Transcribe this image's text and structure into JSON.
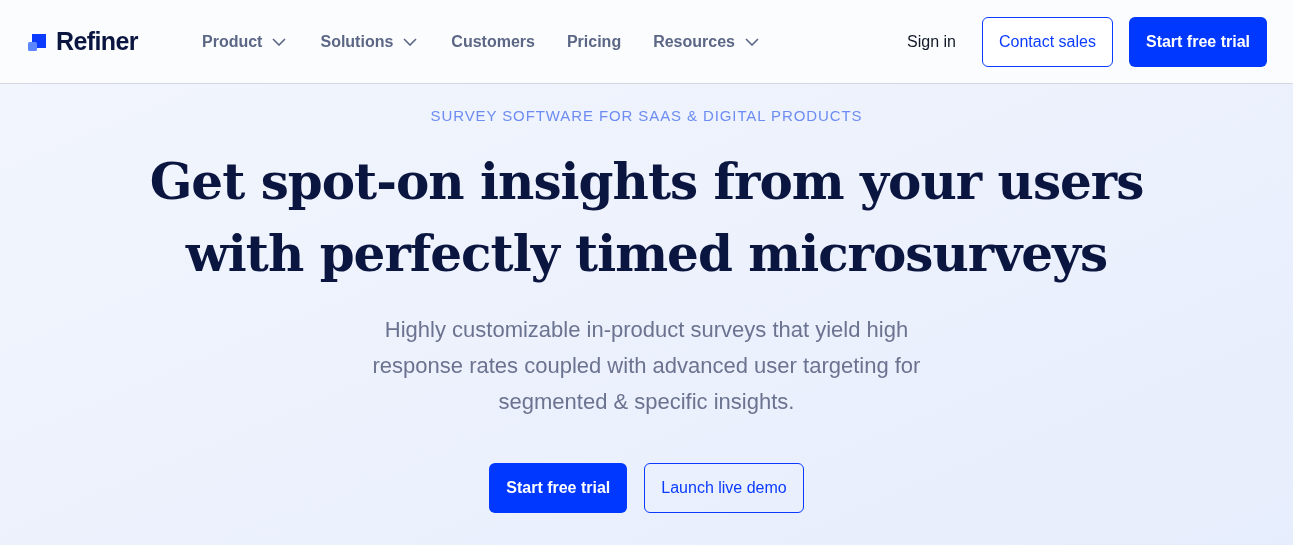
{
  "brand": "Refiner",
  "nav": [
    {
      "label": "Product",
      "has_menu": true
    },
    {
      "label": "Solutions",
      "has_menu": true
    },
    {
      "label": "Customers",
      "has_menu": false
    },
    {
      "label": "Pricing",
      "has_menu": false
    },
    {
      "label": "Resources",
      "has_menu": true
    }
  ],
  "header_actions": [
    {
      "label": "Sign in",
      "kind": "link"
    },
    {
      "label": "Contact sales",
      "kind": "outline"
    },
    {
      "label": "Start free trial",
      "kind": "primary"
    }
  ],
  "hero": {
    "eyebrow": "SURVEY SOFTWARE FOR SAAS & DIGITAL PRODUCTS",
    "heading_lines": [
      "Get spot-on insights from your users",
      "with perfectly timed microsurveys"
    ],
    "subtitle_lines": [
      "Highly customizable in-product surveys that yield high",
      "response rates coupled with advanced user targeting for",
      "segmented & specific insights."
    ],
    "buttons": [
      {
        "label": "Start free trial",
        "kind": "primary"
      },
      {
        "label": "Launch live demo",
        "kind": "outline"
      }
    ]
  }
}
